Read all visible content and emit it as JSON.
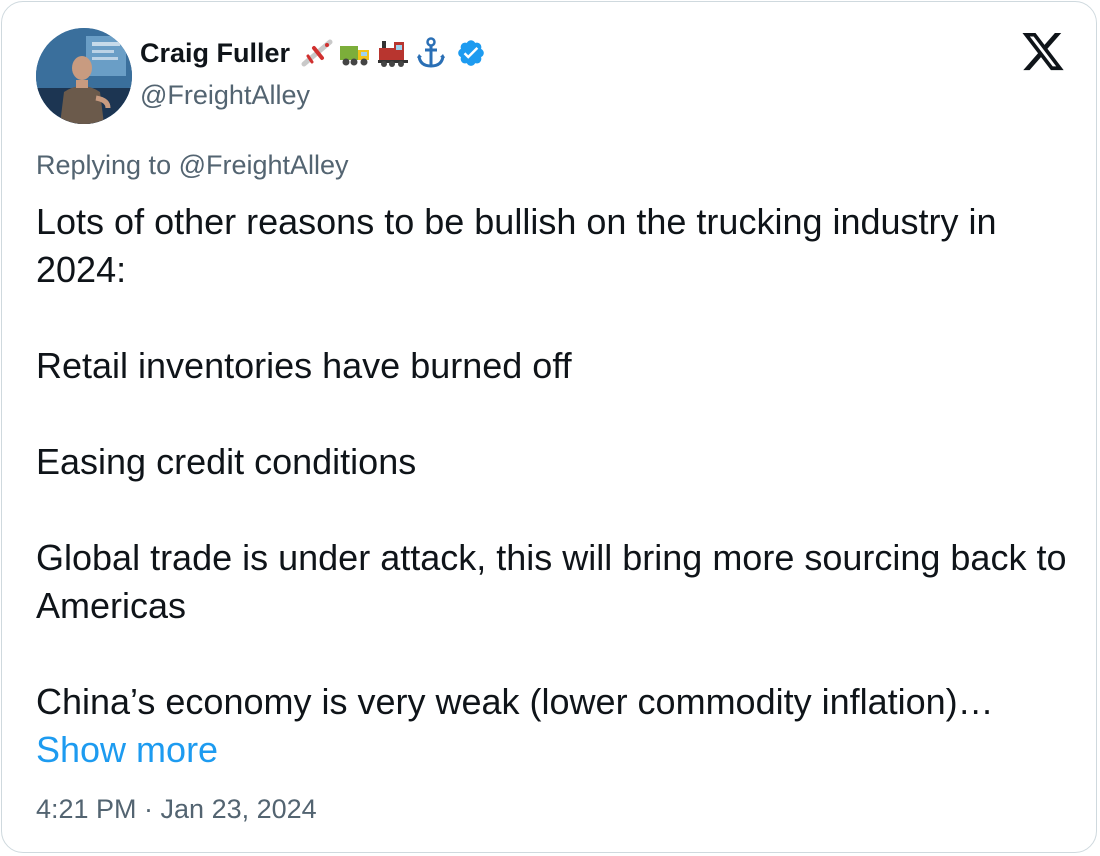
{
  "author": {
    "display_name": "Craig Fuller",
    "handle": "@FreightAlley",
    "emojis": [
      "airplane-icon",
      "truck-icon",
      "train-icon",
      "anchor-icon"
    ],
    "verified": true,
    "verified_color": "#1d9bf0"
  },
  "reply": {
    "text": "Replying to @FreightAlley"
  },
  "tweet": {
    "line_1": "Lots of other reasons to be bullish on the trucking industry in 2024:",
    "line_2": "Retail inventories have burned off",
    "line_3": "Easing credit conditions",
    "line_4": "Global trade is under attack, this will bring more sourcing back to Americas",
    "line_5": "China’s economy is very weak (lower commodity inflation)…",
    "show_more": "Show more"
  },
  "meta": {
    "timestamp": "4:21 PM · Jan 23, 2024"
  },
  "colors": {
    "text": "#0f1419",
    "secondary": "#536471",
    "link": "#1d9bf0",
    "border": "#cfd9de"
  }
}
